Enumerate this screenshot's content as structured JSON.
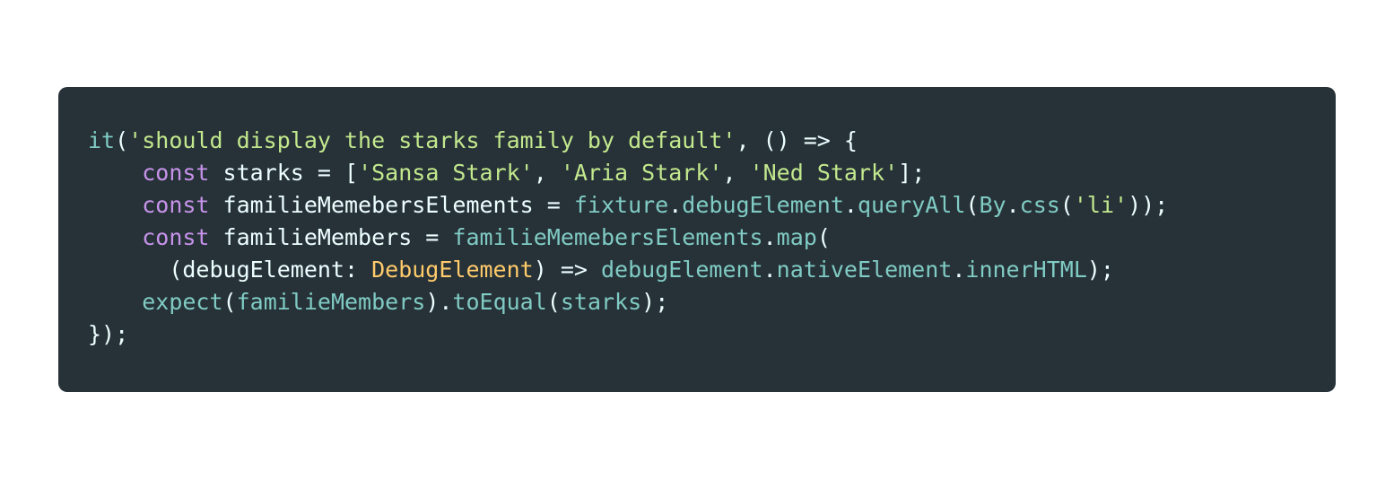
{
  "colors": {
    "page_background": "#ffffff",
    "code_background": "#263238",
    "plain": "#eeffff",
    "keyword": "#c792ea",
    "function": "#80cbc4",
    "string": "#c3e88d",
    "type": "#ffcb6b"
  },
  "code": {
    "language": "typescript",
    "lines": [
      {
        "indent": "",
        "tokens": [
          {
            "text": "it",
            "kind": "function"
          },
          {
            "text": "(",
            "kind": "plain"
          },
          {
            "text": "'should display the starks family by default'",
            "kind": "string"
          },
          {
            "text": ", () => {",
            "kind": "plain"
          }
        ]
      },
      {
        "indent": "    ",
        "tokens": [
          {
            "text": "const",
            "kind": "keyword"
          },
          {
            "text": " starks = [",
            "kind": "plain"
          },
          {
            "text": "'Sansa Stark'",
            "kind": "string"
          },
          {
            "text": ", ",
            "kind": "plain"
          },
          {
            "text": "'Aria Stark'",
            "kind": "string"
          },
          {
            "text": ", ",
            "kind": "plain"
          },
          {
            "text": "'Ned Stark'",
            "kind": "string"
          },
          {
            "text": "];",
            "kind": "plain"
          }
        ]
      },
      {
        "indent": "    ",
        "tokens": [
          {
            "text": "const",
            "kind": "keyword"
          },
          {
            "text": " familieMemebersElements = ",
            "kind": "plain"
          },
          {
            "text": "fixture",
            "kind": "function"
          },
          {
            "text": ".",
            "kind": "plain"
          },
          {
            "text": "debugElement",
            "kind": "function"
          },
          {
            "text": ".",
            "kind": "plain"
          },
          {
            "text": "queryAll",
            "kind": "function"
          },
          {
            "text": "(",
            "kind": "plain"
          },
          {
            "text": "By",
            "kind": "function"
          },
          {
            "text": ".",
            "kind": "plain"
          },
          {
            "text": "css",
            "kind": "function"
          },
          {
            "text": "(",
            "kind": "plain"
          },
          {
            "text": "'li'",
            "kind": "string"
          },
          {
            "text": "));",
            "kind": "plain"
          }
        ]
      },
      {
        "indent": "    ",
        "tokens": [
          {
            "text": "const",
            "kind": "keyword"
          },
          {
            "text": " familieMembers = ",
            "kind": "plain"
          },
          {
            "text": "familieMemebersElements",
            "kind": "function"
          },
          {
            "text": ".",
            "kind": "plain"
          },
          {
            "text": "map",
            "kind": "function"
          },
          {
            "text": "(",
            "kind": "plain"
          }
        ]
      },
      {
        "indent": "      ",
        "tokens": [
          {
            "text": "(debugElement: ",
            "kind": "plain"
          },
          {
            "text": "DebugElement",
            "kind": "type"
          },
          {
            "text": ") => ",
            "kind": "plain"
          },
          {
            "text": "debugElement",
            "kind": "function"
          },
          {
            "text": ".",
            "kind": "plain"
          },
          {
            "text": "nativeElement",
            "kind": "function"
          },
          {
            "text": ".",
            "kind": "plain"
          },
          {
            "text": "innerHTML",
            "kind": "function"
          },
          {
            "text": ");",
            "kind": "plain"
          }
        ]
      },
      {
        "indent": "    ",
        "tokens": [
          {
            "text": "expect",
            "kind": "function"
          },
          {
            "text": "(",
            "kind": "plain"
          },
          {
            "text": "familieMembers",
            "kind": "function"
          },
          {
            "text": ").",
            "kind": "plain"
          },
          {
            "text": "toEqual",
            "kind": "function"
          },
          {
            "text": "(",
            "kind": "plain"
          },
          {
            "text": "starks",
            "kind": "function"
          },
          {
            "text": ");",
            "kind": "plain"
          }
        ]
      },
      {
        "indent": "",
        "tokens": [
          {
            "text": "});",
            "kind": "plain"
          }
        ]
      }
    ]
  }
}
